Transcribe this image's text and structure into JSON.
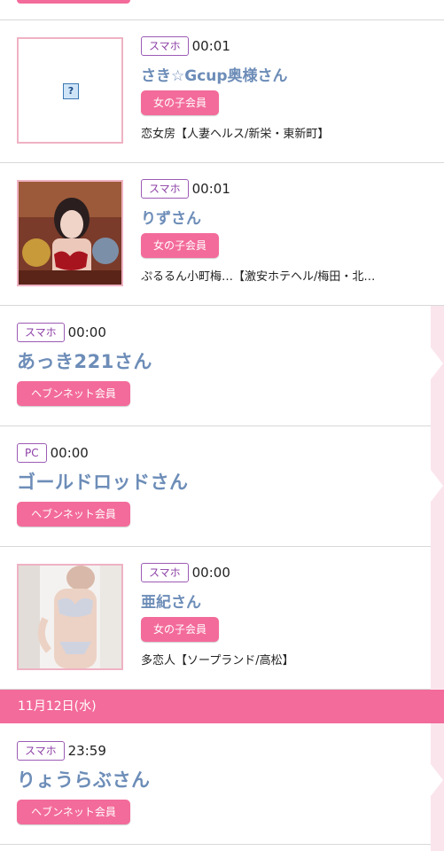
{
  "entries": [
    {
      "device": "スマホ",
      "time": "00:01",
      "name": "さき☆Gcup奥様さん",
      "member_type": "女の子会員",
      "shop": "恋女房【人妻ヘルス/新栄・東新町】",
      "thumbnail": "missing-image-icon"
    },
    {
      "device": "スマホ",
      "time": "00:01",
      "name": "りずさん",
      "member_type": "女の子会員",
      "shop": "ぷるるん小町梅…【激安ホテヘル/梅田・北…",
      "thumbnail": "photo"
    },
    {
      "device": "スマホ",
      "time": "00:00",
      "name": "あっき221さん",
      "member_type": "ヘブンネット会員"
    },
    {
      "device": "PC",
      "time": "00:00",
      "name": "ゴールドロッドさん",
      "member_type": "ヘブンネット会員"
    },
    {
      "device": "スマホ",
      "time": "00:00",
      "name": "亜紀さん",
      "member_type": "女の子会員",
      "shop": "多恋人【ソープランド/高松】",
      "thumbnail": "photo"
    }
  ],
  "date_divider": "11月12日(水)",
  "entries_after": [
    {
      "device": "スマホ",
      "time": "23:59",
      "name": "りょうらぶさん",
      "member_type": "ヘブンネット会員"
    }
  ],
  "colors": {
    "accent_pink": "#f36b9a",
    "name_blue": "#6d8db8",
    "tag_purple": "#8c3fa6"
  }
}
